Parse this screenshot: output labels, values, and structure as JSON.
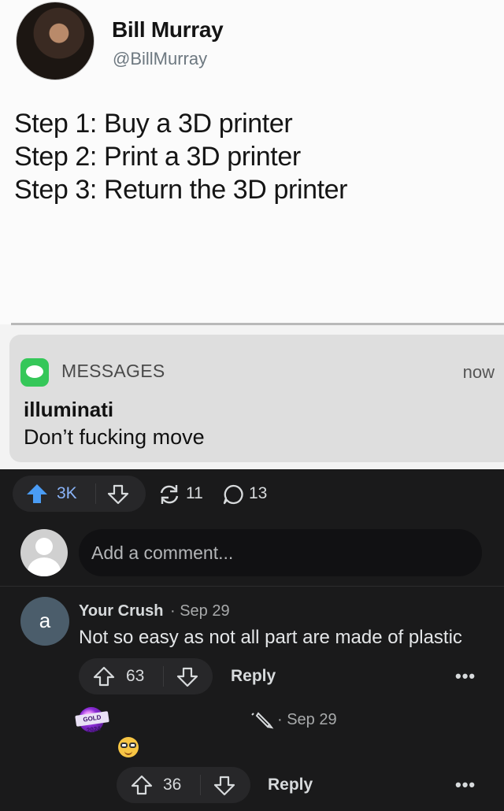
{
  "meme": {
    "tweet": {
      "name": "Bill Murray",
      "handle": "@BillMurray",
      "lines": [
        "Step 1: Buy a 3D printer",
        "Step 2: Print a 3D printer",
        "Step 3: Return the 3D printer"
      ]
    },
    "notification": {
      "app": "MESSAGES",
      "time": "now",
      "title": "illuminati",
      "body": "Don’t fucking move"
    }
  },
  "post_actions": {
    "upvotes": "3K",
    "shares": "11",
    "comments": "13",
    "upvote_color": "#4a9cf5"
  },
  "add_comment": {
    "placeholder": "Add a comment..."
  },
  "comments": [
    {
      "avatar_letter": "a",
      "author": "Your Crush",
      "date": "· Sep 29",
      "body": "Not so easy as not all part are made of plastic",
      "votes": "63",
      "reply_label": "Reply",
      "more_label": "•••"
    },
    {
      "avatar_badge": "GOLD 2024",
      "date": "· Sep 29",
      "emoji": "nerd-face",
      "votes": "36",
      "reply_label": "Reply",
      "more_label": "•••"
    }
  ]
}
